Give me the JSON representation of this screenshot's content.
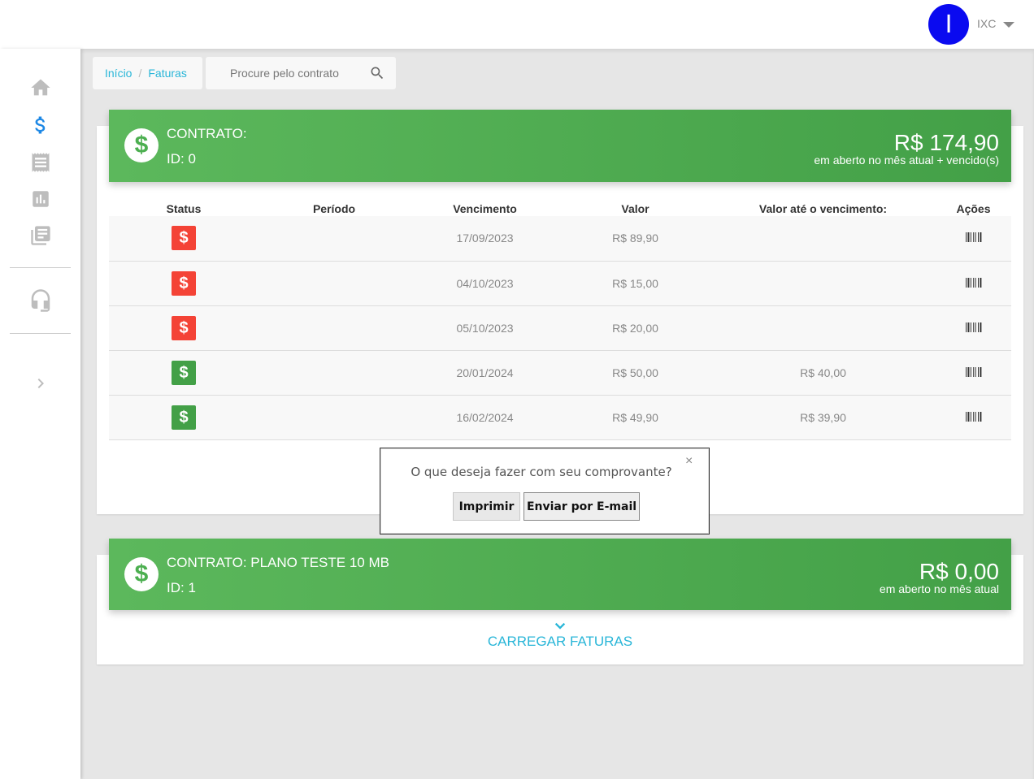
{
  "header": {
    "avatar_letter": "I",
    "username": "IXC"
  },
  "breadcrumb": {
    "items": [
      "Início",
      "Faturas"
    ],
    "separator": "/"
  },
  "search": {
    "placeholder": "Procure pelo contrato"
  },
  "contracts": [
    {
      "label": "CONTRATO:",
      "id_text": "ID: 0",
      "amount": "R$ 174,90",
      "amount_note": "em aberto no mês atual + vencido(s)"
    },
    {
      "label": "CONTRATO: PLANO TESTE 10 MB",
      "id_text": "ID: 1",
      "amount": "R$ 0,00",
      "amount_note": "em aberto no mês atual"
    }
  ],
  "table": {
    "headers": [
      "Status",
      "Período",
      "Vencimento",
      "Valor",
      "Valor até o vencimento:",
      "Ações"
    ],
    "rows": [
      {
        "status": "overdue",
        "status_color": "#f44336",
        "period": "",
        "due": "17/09/2023",
        "value": "R$ 89,90",
        "value_until_due": ""
      },
      {
        "status": "overdue",
        "status_color": "#f44336",
        "period": "",
        "due": "04/10/2023",
        "value": "R$ 15,00",
        "value_until_due": ""
      },
      {
        "status": "overdue",
        "status_color": "#f44336",
        "period": "",
        "due": "05/10/2023",
        "value": "R$ 20,00",
        "value_until_due": ""
      },
      {
        "status": "open",
        "status_color": "#43a047",
        "period": "",
        "due": "20/01/2024",
        "value": "R$ 50,00",
        "value_until_due": "R$ 40,00"
      },
      {
        "status": "open",
        "status_color": "#43a047",
        "period": "",
        "due": "16/02/2024",
        "value": "R$ 49,90",
        "value_until_due": "R$ 39,90"
      }
    ]
  },
  "dialog": {
    "message": "O que deseja fazer com seu comprovante?",
    "close": "×",
    "print_label": "Imprimir",
    "email_label": "Enviar por E-mail"
  },
  "load_more": {
    "label": "CARREGAR FATURAS"
  },
  "colors": {
    "accent": "#29b6d8",
    "header_green": "#4caf50",
    "overdue_red": "#f44336",
    "open_green": "#43a047"
  }
}
